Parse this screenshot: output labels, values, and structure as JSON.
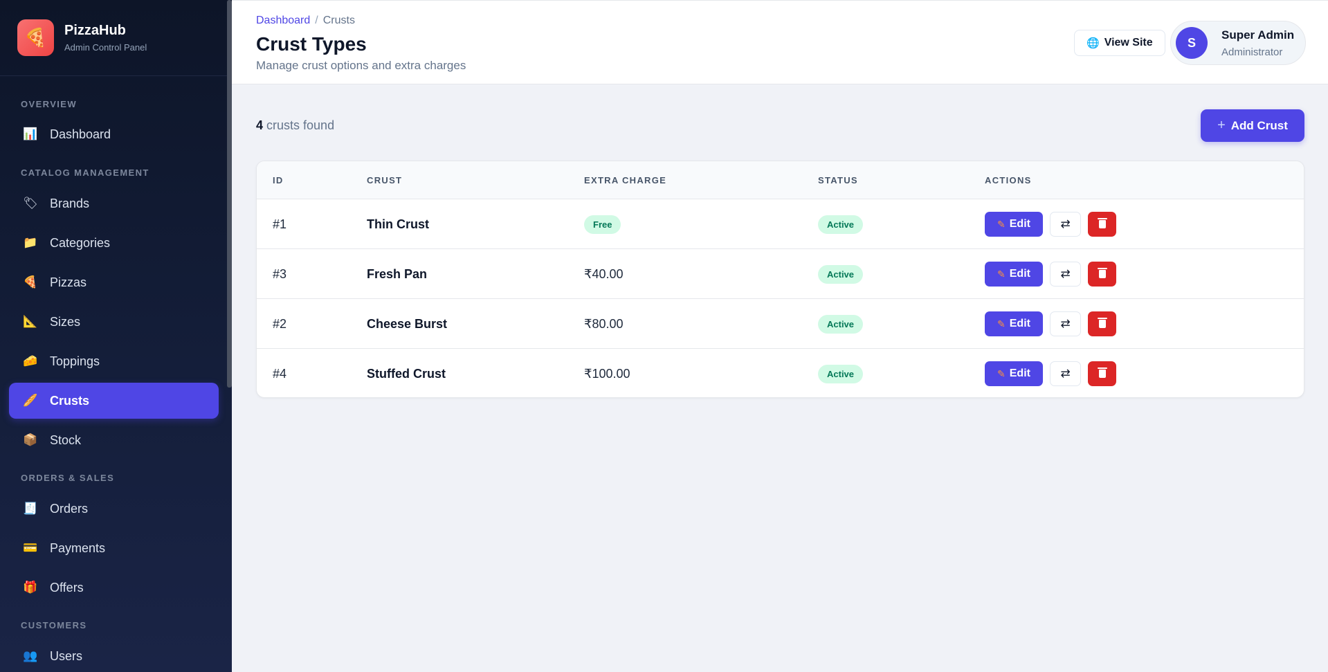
{
  "brand": {
    "name": "PizzaHub",
    "subtitle": "Admin Control Panel",
    "logo_icon": "pizza-icon"
  },
  "sidebar": {
    "sections": {
      "overview": "OVERVIEW",
      "catalog": "CATALOG MANAGEMENT",
      "orders": "ORDERS & SALES",
      "customers": "CUSTOMERS"
    },
    "items": [
      {
        "label": "Dashboard",
        "icon": "bar-chart-icon",
        "glyph": "📊"
      },
      {
        "label": "Brands",
        "icon": "tag-icon",
        "glyph": "🏷"
      },
      {
        "label": "Categories",
        "icon": "folder-icon",
        "glyph": "📁"
      },
      {
        "label": "Pizzas",
        "icon": "pizza-icon",
        "glyph": "🍕"
      },
      {
        "label": "Sizes",
        "icon": "ruler-icon",
        "glyph": "📐"
      },
      {
        "label": "Toppings",
        "icon": "cheese-icon",
        "glyph": "🧀"
      },
      {
        "label": "Crusts",
        "icon": "bread-icon",
        "glyph": "🥖",
        "active": true
      },
      {
        "label": "Stock",
        "icon": "box-icon",
        "glyph": "📦"
      },
      {
        "label": "Orders",
        "icon": "receipt-icon",
        "glyph": "🧾"
      },
      {
        "label": "Payments",
        "icon": "credit-card-icon",
        "glyph": "💳"
      },
      {
        "label": "Offers",
        "icon": "gift-icon",
        "glyph": "🎁"
      },
      {
        "label": "Users",
        "icon": "users-icon",
        "glyph": "👥"
      }
    ]
  },
  "header": {
    "breadcrumb": {
      "link": "Dashboard",
      "separator": "/",
      "current": "Crusts"
    },
    "title": "Crust Types",
    "subtitle": "Manage crust options and extra charges",
    "view_site_label": "View Site",
    "view_site_icon": "globe-icon",
    "user": {
      "initial": "S",
      "name": "Super Admin",
      "role": "Administrator"
    }
  },
  "main": {
    "count": "4",
    "count_suffix": "crusts found",
    "add_button_label": "Add Crust",
    "table": {
      "headers": [
        "ID",
        "CRUST",
        "EXTRA CHARGE",
        "STATUS",
        "ACTIONS"
      ],
      "rows": [
        {
          "id": "#1",
          "crust": "Thin Crust",
          "extra_charge": "Free",
          "charge_is_badge": true,
          "status": "Active"
        },
        {
          "id": "#3",
          "crust": "Fresh Pan",
          "extra_charge": "₹40.00",
          "charge_is_badge": false,
          "status": "Active"
        },
        {
          "id": "#2",
          "crust": "Cheese Burst",
          "extra_charge": "₹80.00",
          "charge_is_badge": false,
          "status": "Active"
        },
        {
          "id": "#4",
          "crust": "Stuffed Crust",
          "extra_charge": "₹100.00",
          "charge_is_badge": false,
          "status": "Active"
        }
      ],
      "edit_label": "Edit",
      "toggle_glyph": "⇄"
    }
  },
  "colors": {
    "accent": "#4f46e5",
    "danger": "#dc2626",
    "success_bg": "#d1fae5",
    "success_text": "#047857",
    "sidebar_bg": "#0d1528"
  }
}
